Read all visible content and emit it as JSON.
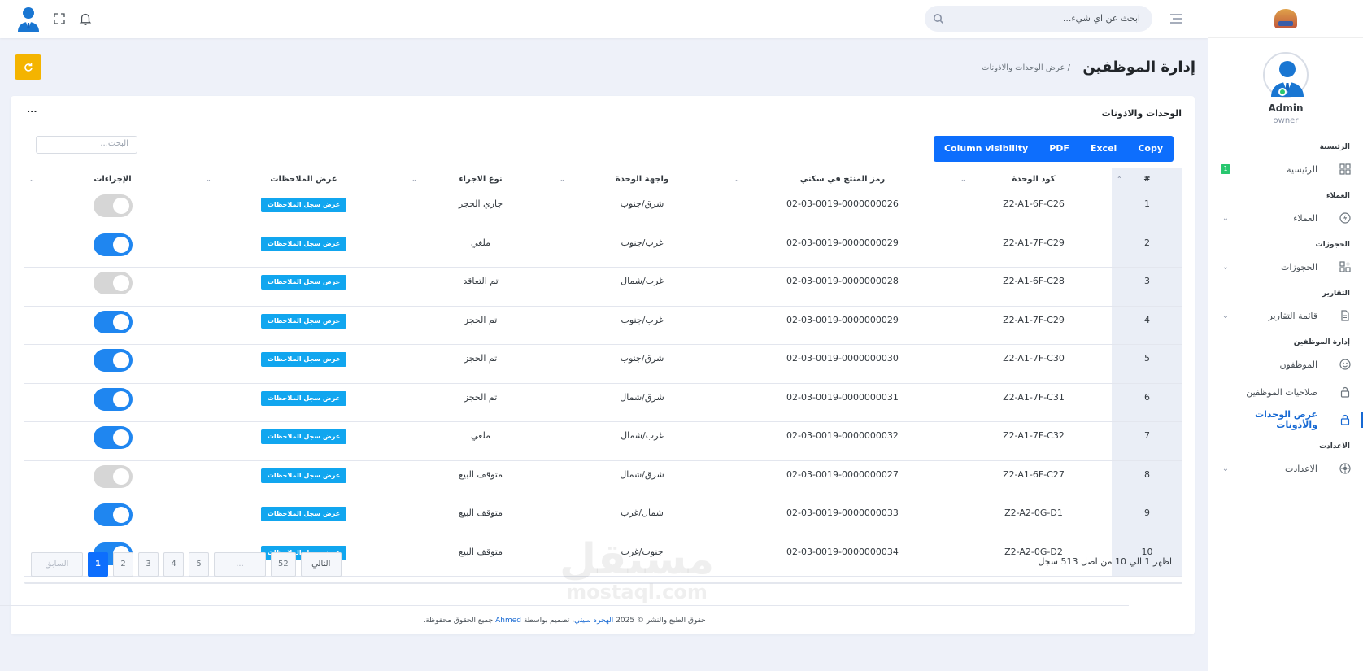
{
  "topbar": {
    "search_placeholder": "ابحث عن اي شيء...",
    "icons": [
      "menu-icon",
      "search-icon",
      "bell-icon",
      "fullscreen-icon",
      "user-avatar"
    ]
  },
  "sidebar": {
    "user_name": "Admin",
    "user_role": "owner",
    "sections": {
      "home": "الرئيسية",
      "clients": "العملاء",
      "bookings": "الحجوزات",
      "reports": "التقارير",
      "employees": "إدارة الموظفين",
      "settings": "الاعدادت"
    },
    "items": {
      "home": {
        "label": "الرئيسية",
        "badge": "1"
      },
      "clients": {
        "label": "العملاء"
      },
      "bookings": {
        "label": "الحجوزات"
      },
      "reports": {
        "label": "قائمة التقارير"
      },
      "employees": {
        "label": "الموظفون"
      },
      "permissions": {
        "label": "صلاحيات الموظفين"
      },
      "units": {
        "label": "عرض الوحدات والأذونات"
      },
      "settings": {
        "label": "الاعدادت"
      }
    }
  },
  "page": {
    "title": "إدارة الموظفين",
    "breadcrumb": "/ عرض الوحدات والاذونات"
  },
  "card": {
    "title": "الوحدات والاذونات",
    "menu": "...",
    "buttons": {
      "copy": "Copy",
      "excel": "Excel",
      "pdf": "PDF",
      "colvis": "Column visibility"
    },
    "search_placeholder": "البحث..."
  },
  "table": {
    "headers": {
      "num": "#",
      "unit_code": "كود الوحدة",
      "sku": "رمز المنتج في سكني",
      "facade": "واجهة الوحدة",
      "action_type": "نوع الاجراء",
      "notes": "عرض الملاحظات",
      "actions": "الإجراءات"
    },
    "notes_button": "عرض سجل الملاحظات",
    "rows": [
      {
        "num": "1",
        "unit_code": "Z2-A1-6F-C26",
        "sku": "02-03-0019-0000000026",
        "facade": "شرق/جنوب",
        "action_type": "جاري الحجز",
        "active": false
      },
      {
        "num": "2",
        "unit_code": "Z2-A1-7F-C29",
        "sku": "02-03-0019-0000000029",
        "facade": "غرب/جنوب",
        "action_type": "ملغي",
        "active": true
      },
      {
        "num": "3",
        "unit_code": "Z2-A1-6F-C28",
        "sku": "02-03-0019-0000000028",
        "facade": "غرب/شمال",
        "action_type": "تم التعاقد",
        "active": false
      },
      {
        "num": "4",
        "unit_code": "Z2-A1-7F-C29",
        "sku": "02-03-0019-0000000029",
        "facade": "غرب/جنوب",
        "action_type": "تم الحجز",
        "active": true
      },
      {
        "num": "5",
        "unit_code": "Z2-A1-7F-C30",
        "sku": "02-03-0019-0000000030",
        "facade": "شرق/جنوب",
        "action_type": "تم الحجز",
        "active": true
      },
      {
        "num": "6",
        "unit_code": "Z2-A1-7F-C31",
        "sku": "02-03-0019-0000000031",
        "facade": "شرق/شمال",
        "action_type": "تم الحجز",
        "active": true
      },
      {
        "num": "7",
        "unit_code": "Z2-A1-7F-C32",
        "sku": "02-03-0019-0000000032",
        "facade": "غرب/شمال",
        "action_type": "ملغي",
        "active": true
      },
      {
        "num": "8",
        "unit_code": "Z2-A1-6F-C27",
        "sku": "02-03-0019-0000000027",
        "facade": "شرق/شمال",
        "action_type": "متوقف البيع",
        "active": false
      },
      {
        "num": "9",
        "unit_code": "Z2-A2-0G-D1",
        "sku": "02-03-0019-0000000033",
        "facade": "شمال/غرب",
        "action_type": "متوقف البيع",
        "active": true
      },
      {
        "num": "10",
        "unit_code": "Z2-A2-0G-D2",
        "sku": "02-03-0019-0000000034",
        "facade": "جنوب/غرب",
        "action_type": "متوقف البيع",
        "active": true
      }
    ]
  },
  "pagination": {
    "info": "اظهر 1 الي 10 من اصل 513 سجل",
    "prev": "السابق",
    "pages": [
      "1",
      "2",
      "3",
      "4",
      "5"
    ],
    "ellipsis": "...",
    "last": "52",
    "next": "التالي"
  },
  "watermark": {
    "ar": "مستقل",
    "en": "mostaql.com"
  },
  "footer": {
    "text_before": "حقوق الطبع والنشر © 2025",
    "brand": "الهجره سيتي",
    "text_mid": "، تصميم بواسطة",
    "author": "Ahmed",
    "text_after": "جميع الحقوق محفوظة."
  },
  "colors": {
    "primary": "#0d6efd",
    "accent_yellow": "#f4b400",
    "notes_btn": "#11a6ef",
    "toggle_on": "#1f86f0",
    "badge": "#28c76f"
  }
}
